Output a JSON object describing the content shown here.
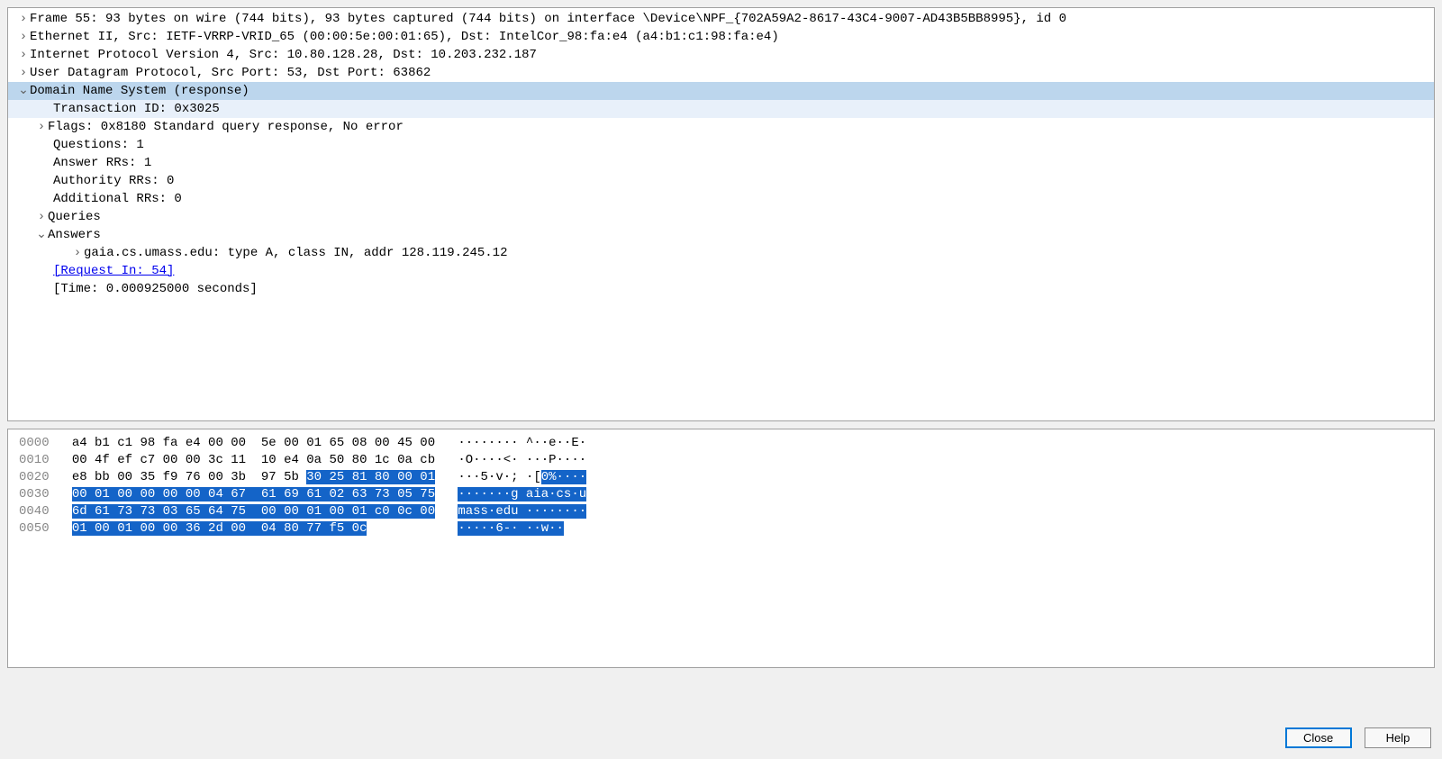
{
  "details": {
    "frame": "Frame 55: 93 bytes on wire (744 bits), 93 bytes captured (744 bits) on interface \\Device\\NPF_{702A59A2-8617-43C4-9007-AD43B5BB8995}, id 0",
    "eth": "Ethernet II, Src: IETF-VRRP-VRID_65 (00:00:5e:00:01:65), Dst: IntelCor_98:fa:e4 (a4:b1:c1:98:fa:e4)",
    "ip": "Internet Protocol Version 4, Src: 10.80.128.28, Dst: 10.203.232.187",
    "udp": "User Datagram Protocol, Src Port: 53, Dst Port: 63862",
    "dns": "Domain Name System (response)",
    "txid": "Transaction ID: 0x3025",
    "flags": "Flags: 0x8180 Standard query response, No error",
    "q": "Questions: 1",
    "an": "Answer RRs: 1",
    "auth": "Authority RRs: 0",
    "add": "Additional RRs: 0",
    "queries": "Queries",
    "answers": "Answers",
    "ansrow": "gaia.cs.umass.edu: type A, class IN, addr 128.119.245.12",
    "reqin": "[Request In: 54]",
    "time": "[Time: 0.000925000 seconds]"
  },
  "hex": {
    "l0": {
      "off": "0000",
      "a": "a4 b1 c1 98 fa e4 00 00  5e 00 01 65 08 00 45 00",
      "t": "········ ^··e··E·"
    },
    "l1": {
      "off": "0010",
      "a": "00 4f ef c7 00 00 3c 11  10 e4 0a 50 80 1c 0a cb",
      "t": "·O····<· ···P····"
    },
    "l2": {
      "off": "0020",
      "a": "e8 bb 00 35 f9 76 00 3b  97 5b ",
      "sel": "30 25 81 80 00 01",
      "ta": "···5·v·; ·[",
      "tsel": "0%····"
    },
    "l3": {
      "off": "0030",
      "sel": "00 01 00 00 00 00 04 67  61 69 61 02 63 73 05 75",
      "tsel": "·······g aia·cs·u"
    },
    "l4": {
      "off": "0040",
      "sel": "6d 61 73 73 03 65 64 75  00 00 01 00 01 c0 0c 00",
      "tsel": "mass·edu ········"
    },
    "l5": {
      "off": "0050",
      "sel": "01 00 01 00 00 36 2d 00  04 80 77 f5 0c",
      "tsel": "·····6-· ··w··"
    }
  },
  "buttons": {
    "close": "Close",
    "help": "Help"
  }
}
